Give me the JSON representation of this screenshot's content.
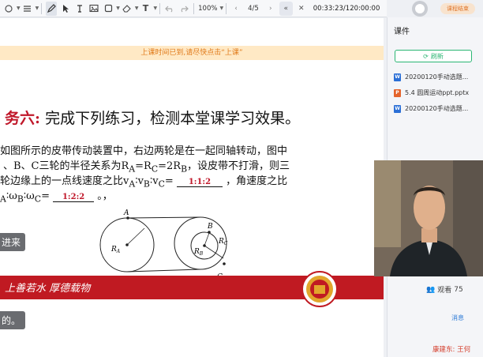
{
  "toolbar": {
    "zoom": "100%",
    "page": "4/5",
    "timer": "00:33:23/120:00:00",
    "brand_button": "课程结束"
  },
  "panel": {
    "title": "课件",
    "refresh_label": "刷新",
    "files": [
      {
        "name": "20200120手动选题...",
        "type": "W",
        "color": "#2b6fd6"
      },
      {
        "name": "5.4 圆周运动ppt.pptx",
        "type": "P",
        "color": "#e4642c"
      },
      {
        "name": "20200120手动选题...",
        "type": "W",
        "color": "#2b6fd6"
      }
    ],
    "viewers_label": "观看",
    "viewers_count": "75",
    "messages_label": "消息",
    "chat_name": "康建东: 王何"
  },
  "slide": {
    "banner": "上课时间已到,请尽快点击“上课”",
    "title_red": "务六:",
    "title_rest": "完成下列练习，检测本堂课学习效果。",
    "q_line1": "如图所示的皮带传动装置中，右边两轮是在一起同轴转动，图中",
    "q_line2_a": "、B、C三轮的半径关系为R",
    "q_line2_b": "A",
    "q_line2_c": "=R",
    "q_line2_d": "C",
    "q_line2_e": "=2R",
    "q_line2_f": "B",
    "q_line2_g": "，设皮带不打滑，则三",
    "q_line3_a": "轮边缘上的一点线速度之比v",
    "q_line3_b": "A",
    "q_line3_c": "∶v",
    "q_line3_d": "B",
    "q_line3_e": "∶v",
    "q_line3_f": "C",
    "q_line3_g": "=",
    "answer1": "1:1:2",
    "q_line3_h": "，角速度之比",
    "q_line4_a": "A",
    "q_line4_b": "∶ω",
    "q_line4_c": "B",
    "q_line4_d": "∶ω",
    "q_line4_e": "C",
    "q_line4_f": "=",
    "answer2": "1:2:2",
    "q_line4_g": "。，",
    "tag1": "进来",
    "tag2": "的。",
    "slogan": "上善若水  厚德载物",
    "labels": {
      "A": "A",
      "B": "B",
      "C": "C",
      "RA": "R",
      "RA_sub": "A",
      "RB": "R",
      "RB_sub": "B",
      "RC": "R",
      "RC_sub": "C"
    }
  },
  "colors": {
    "accent": "#2bb673",
    "red": "#c01a22",
    "answer": "#c0182a"
  }
}
